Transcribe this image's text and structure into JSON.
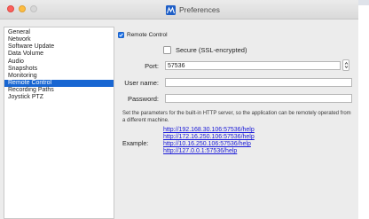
{
  "window": {
    "title": "Preferences",
    "colors": {
      "accent": "#1866d2",
      "link": "#1a1ad8",
      "close": "#fc605c",
      "minimize": "#fdbc40"
    }
  },
  "sidebar": {
    "items": [
      {
        "label": "General",
        "selected": false
      },
      {
        "label": "Network",
        "selected": false
      },
      {
        "label": "Software Update",
        "selected": false
      },
      {
        "label": "Data Volume",
        "selected": false
      },
      {
        "label": "Audio",
        "selected": false
      },
      {
        "label": "Snapshots",
        "selected": false
      },
      {
        "label": "Monitoring",
        "selected": false
      },
      {
        "label": "Remote Control",
        "selected": true
      },
      {
        "label": "Recording Paths",
        "selected": false
      },
      {
        "label": "Joystick PTZ",
        "selected": false
      }
    ]
  },
  "remote_control": {
    "enabled_label": "Remote Control",
    "enabled": true,
    "secure_label": "Secure (SSL-encrypted)",
    "secure": false,
    "port_label": "Port:",
    "port_value": "57536",
    "username_label": "User name:",
    "username_value": "",
    "password_label": "Password:",
    "password_value": "",
    "description": "Set the parameters for the built-in HTTP server, so the application can be remotely operated from a different machine.",
    "example_label": "Example:",
    "example_links": [
      "http://192.168.30.106:57536/help",
      "http://172.16.250.106:57536/help",
      "http://10.16.250.106:57536/help",
      "http://127.0.0.1:57536/help"
    ]
  }
}
